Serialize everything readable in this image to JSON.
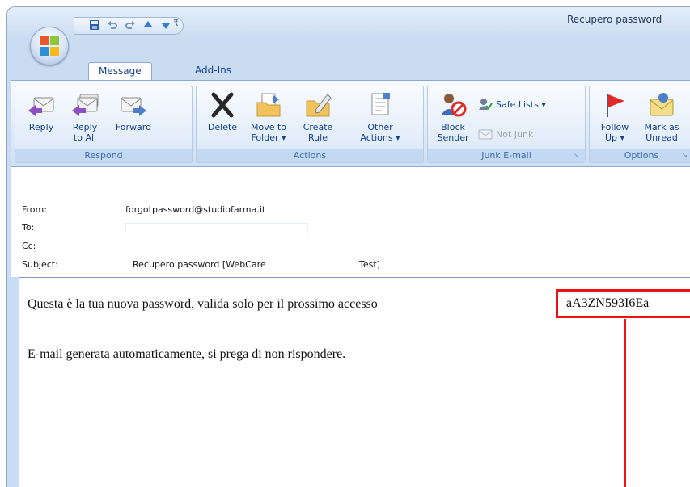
{
  "window": {
    "title": "Recupero password"
  },
  "quick_access": {
    "icons": [
      "save-icon",
      "undo-icon",
      "redo-icon",
      "previous-item-icon",
      "next-item-icon",
      "customize-dropdown-icon"
    ]
  },
  "tabs": [
    {
      "label": "Message",
      "active": true
    },
    {
      "label": "Add-Ins",
      "active": false
    }
  ],
  "ribbon": {
    "respond": {
      "label": "Respond",
      "reply": "Reply",
      "reply_all_1": "Reply",
      "reply_all_2": "to All",
      "forward": "Forward"
    },
    "actions": {
      "label": "Actions",
      "delete": "Delete",
      "move_1": "Move to",
      "move_2": "Folder ▾",
      "rule_1": "Create",
      "rule_2": "Rule",
      "other_1": "Other",
      "other_2": "Actions ▾"
    },
    "junk": {
      "label": "Junk E-mail",
      "block_1": "Block",
      "block_2": "Sender",
      "safe_lists": "Safe Lists ▾",
      "not_junk": "Not Junk"
    },
    "options": {
      "label": "Options",
      "follow_1": "Follow",
      "follow_2": "Up ▾",
      "mark_1": "Mark as",
      "mark_2": "Unread"
    }
  },
  "header": {
    "from_label": "From:",
    "from_value": "forgotpassword@studiofarma.it",
    "to_label": "To:",
    "to_value": "",
    "cc_label": "Cc:",
    "subject_label": "Subject:",
    "subject_value_1": "Recupero password [WebCare",
    "subject_value_2": "Test]"
  },
  "body": {
    "line1": "Questa è la tua nuova password, valida solo per il prossimo accesso",
    "password": "aA3ZN593I6Ea",
    "line2": "E-mail generata automaticamente, si prega di non rispondere."
  },
  "colors": {
    "highlight": "#ee1111",
    "ribbon_text": "#15428b",
    "group_label": "#3e6aaa"
  }
}
